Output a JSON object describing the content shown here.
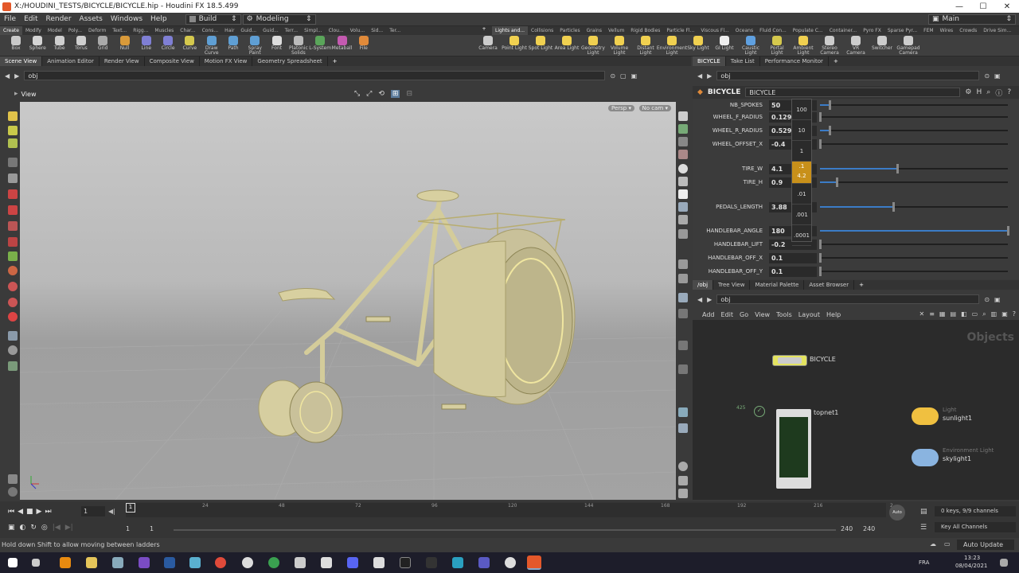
{
  "window": {
    "title": "X:/HOUDINI_TESTS/BICYCLE/BICYCLE.hip - Houdini FX 18.5.499",
    "controls": [
      "—",
      "☐",
      "✕"
    ]
  },
  "menu": [
    "File",
    "Edit",
    "Render",
    "Assets",
    "Windows",
    "Help"
  ],
  "desktop_combo": "Build",
  "workspace_combo": "Modeling",
  "main_combo": "Main",
  "shelf_tabs_left": [
    "Create",
    "Modify",
    "Model",
    "Poly...",
    "Deform",
    "Text...",
    "Rigg...",
    "Muscles",
    "Char...",
    "Cons...",
    "Hair",
    "Guid...",
    "Guid...",
    "Terr...",
    "Simpl...",
    "Clou...",
    "Volu...",
    "Sid...",
    "Ter..."
  ],
  "shelf_tabs_right": [
    "Lights and...",
    "Collisions",
    "Particles",
    "Grains",
    "Vellum",
    "Rigid Bodies",
    "Particle Fl...",
    "Viscous Fl...",
    "Oceans",
    "Fluid Con...",
    "Populate C...",
    "Container...",
    "Pyro FX",
    "Sparse Pyr...",
    "FEM",
    "Wires",
    "Crowds",
    "Drive Sim..."
  ],
  "shelf_tools_left": [
    {
      "label": "Box",
      "color": "#c9c9c9"
    },
    {
      "label": "Sphere",
      "color": "#d4d4d4"
    },
    {
      "label": "Tube",
      "color": "#cfcfcf"
    },
    {
      "label": "Torus",
      "color": "#cfcfcf"
    },
    {
      "label": "Grid",
      "color": "#aaaaaa"
    },
    {
      "label": "Null",
      "color": "#d99a3a"
    },
    {
      "label": "Line",
      "color": "#7f7fd4"
    },
    {
      "label": "Circle",
      "color": "#7f7fd4"
    },
    {
      "label": "Curve",
      "color": "#d4c84d"
    },
    {
      "label": "Draw Curve",
      "color": "#5f9fd4"
    },
    {
      "label": "Path",
      "color": "#5f9fd4"
    },
    {
      "label": "Spray Paint",
      "color": "#5f9fd4"
    },
    {
      "label": "Font",
      "color": "#dddddd"
    },
    {
      "label": "Platonic Solids",
      "color": "#bbbbbb"
    },
    {
      "label": "L-System",
      "color": "#5aa55a"
    },
    {
      "label": "Metaball",
      "color": "#c45ab0"
    },
    {
      "label": "File",
      "color": "#e08a3a"
    }
  ],
  "shelf_tools_right": [
    {
      "label": "Camera",
      "color": "#cccccc"
    },
    {
      "label": "Point Light",
      "color": "#f0d050"
    },
    {
      "label": "Spot Light",
      "color": "#f0d050"
    },
    {
      "label": "Area Light",
      "color": "#f0d050"
    },
    {
      "label": "Geometry Light",
      "color": "#f0d050"
    },
    {
      "label": "Volume Light",
      "color": "#f0d050"
    },
    {
      "label": "Distant Light",
      "color": "#f0d050"
    },
    {
      "label": "Environment Light",
      "color": "#f0d050"
    },
    {
      "label": "Sky Light",
      "color": "#f0d050"
    },
    {
      "label": "GI Light",
      "color": "#eeeeee"
    },
    {
      "label": "Caustic Light",
      "color": "#5fa0e0"
    },
    {
      "label": "Portal Light",
      "color": "#d4c84d"
    },
    {
      "label": "Ambient Light",
      "color": "#f0d050"
    },
    {
      "label": "Stereo Camera",
      "color": "#cccccc"
    },
    {
      "label": "VR Camera",
      "color": "#cccccc"
    },
    {
      "label": "Switcher",
      "color": "#cccccc"
    },
    {
      "label": "Gamepad Camera",
      "color": "#cccccc"
    }
  ],
  "left_pane_tabs": [
    "Scene View",
    "Animation Editor",
    "Render View",
    "Composite View",
    "Motion FX View",
    "Geometry Spreadsheet"
  ],
  "left_path": "obj",
  "viewport": {
    "label": "View",
    "persp": "Persp ▾",
    "cam": "No cam ▾"
  },
  "right_top_tabs": [
    "BICYCLE",
    "Take List",
    "Performance Monitor"
  ],
  "right_top_path": "obj",
  "params_header": {
    "node_type": "BICYCLE",
    "node_name": "BICYCLE"
  },
  "params": [
    {
      "label": "NB_SPOKES",
      "value": "50",
      "fill": 0.05
    },
    {
      "label": "WHEEL_F_RADIUS",
      "value": "0.129",
      "fill": 0.0
    },
    {
      "label": "WHEEL_R_RADIUS",
      "value": "0.529",
      "fill": 0.05
    },
    {
      "label": "WHEEL_OFFSET_X",
      "value": "-0.4",
      "fill": 0.0
    },
    {
      "label": "TIRE_W",
      "value": "4.1",
      "fill": 0.41
    },
    {
      "label": "TIRE_H",
      "value": "0.9",
      "fill": 0.09
    },
    {
      "label": "PEDALS_LENGTH",
      "value": "3.88",
      "fill": 0.388
    },
    {
      "label": "HANDLEBAR_ANGLE",
      "value": "180",
      "fill": 1.0
    },
    {
      "label": "HANDLEBAR_LIFT",
      "value": "-0.2",
      "fill": 0.0
    },
    {
      "label": "HANDLEBAR_OFF_X",
      "value": "0.1",
      "fill": 0.0
    },
    {
      "label": "HANDLEBAR_OFF_Y",
      "value": "0.1",
      "fill": 0.0
    }
  ],
  "ladder": [
    "100",
    "10",
    "1",
    ".1",
    "4.2",
    ".01",
    ".001",
    ".0001"
  ],
  "net_tabs": [
    "/obj",
    "Tree View",
    "Material Palette",
    "Asset Browser"
  ],
  "net_path": "obj",
  "net_menu": [
    "Add",
    "Edit",
    "Go",
    "View",
    "Tools",
    "Layout",
    "Help"
  ],
  "net_title": "Objects",
  "nodes": {
    "bicycle": "BICYCLE",
    "topnet": "topnet1",
    "topnet_count": "425",
    "sunlight_type": "Light",
    "sunlight": "sunlight1",
    "skylight_type": "Environment Light",
    "skylight": "skylight1"
  },
  "timeline": {
    "frame": "1",
    "ticks": [
      "1",
      "24",
      "48",
      "72",
      "96",
      "120",
      "144",
      "168",
      "192",
      "216",
      "2"
    ],
    "start": "1",
    "start2": "1",
    "end": "240",
    "end2": "240",
    "keys": "0 keys, 9/9 channels",
    "key_all": "Key All Channels",
    "auto": "Auto"
  },
  "status": {
    "message": "Hold down Shift to allow moving between ladders",
    "update": "Auto Update"
  },
  "taskbar": {
    "lang": "FRA",
    "time": "13:23",
    "date": "08/04/2021"
  }
}
